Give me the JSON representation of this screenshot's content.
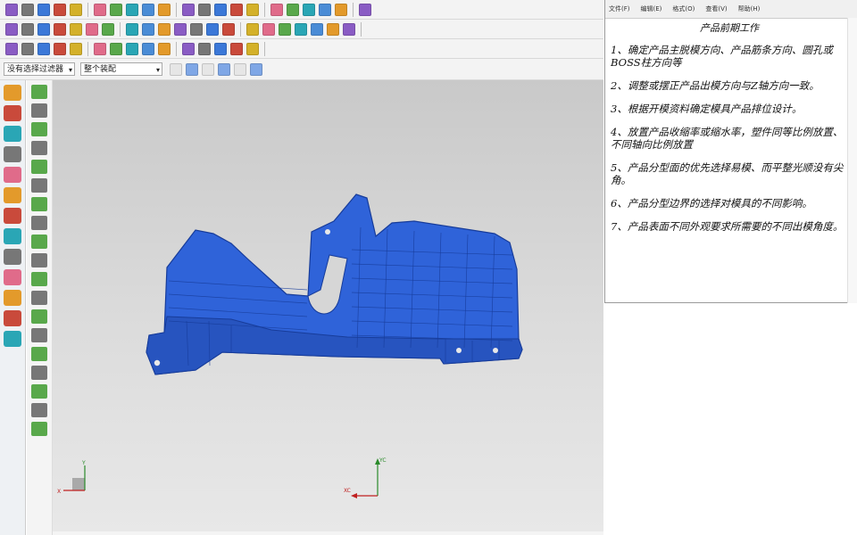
{
  "toolbar": {
    "row1_icons": [
      "start-icon",
      "new-file-icon",
      "open-folder-icon",
      "save-icon",
      "cut-icon",
      "undo-icon",
      "redo-icon",
      "refresh-icon",
      "sketch-icon",
      "grid-icon",
      "fit-view-icon",
      "zoom-icon",
      "box-view-icon",
      "rotate-icon",
      "pan-icon",
      "paint-icon",
      "shaded-icon",
      "wireframe-icon",
      "cube-icon",
      "magnet-icon",
      "line-tool-icon"
    ],
    "row2_icons": [
      "select-icon",
      "curve-icon",
      "extrude-icon",
      "revolve-icon",
      "hole-icon",
      "boss-icon",
      "blend-icon",
      "chamfer-icon",
      "shell-icon",
      "draft-icon",
      "trim-icon",
      "pattern-icon",
      "mirror-icon",
      "unite-icon",
      "subtract-icon",
      "intersect-icon",
      "offset-icon",
      "thicken-icon",
      "sweep-icon",
      "emboss-icon",
      "rib-icon"
    ],
    "row3_icons": [
      "measure-icon",
      "analyze-icon",
      "section-icon",
      "color-icon",
      "layer-icon",
      "move-face-icon",
      "replace-face-icon",
      "delete-face-icon",
      "split-body-icon",
      "mold-tool-icon",
      "parting-icon",
      "slider-icon",
      "lifter-icon",
      "insert-icon",
      "sprue-icon"
    ],
    "filter_combo": "没有选择过滤器",
    "assembly_combo": "整个装配",
    "snap_icons": [
      "snap-end-icon",
      "snap-mid-icon",
      "snap-center-icon",
      "snap-point-icon",
      "snap-quadrant-icon",
      "snap-intersect-icon"
    ]
  },
  "left_rail": {
    "icons": [
      "settings-icon",
      "part-nav-icon",
      "assembly-nav-icon",
      "constraint-icon",
      "reuse-library-icon",
      "web-browser-icon",
      "history-icon",
      "roles-icon",
      "system-materials-icon",
      "hd3d-icon",
      "palette-icon",
      "print-icon",
      "help-icon"
    ]
  },
  "tool_column": {
    "icons": [
      "init-project-icon",
      "workpiece-icon",
      "csys-icon",
      "shrink-icon",
      "layout-icon",
      "family-icon",
      "cavity-icon",
      "mold-base-icon",
      "standard-part-icon",
      "ejector-icon",
      "cooling-icon",
      "electrode-icon",
      "bom-icon",
      "drawing-icon",
      "trim-tool-icon",
      "pocket-icon",
      "view-manager-icon",
      "delete-icon",
      "cleanup-icon"
    ]
  },
  "notes": {
    "menu": [
      "文件(F)",
      "编辑(E)",
      "格式(O)",
      "查看(V)",
      "帮助(H)"
    ],
    "title": "产品前期工作",
    "items": [
      "1、确定产品主脱模方向、产品筋条方向、圆孔或BOSS柱方向等",
      "2、调整或摆正产品出模方向与Z轴方向一致。",
      "3、根据开模资料确定模具产品排位设计。",
      "4、放置产品收缩率或缩水率，塑件同等比例放置、不同轴向比例放置",
      "5、产品分型面的优先选择易模、而平整光顺没有尖角。",
      "6、产品分型边界的选择对模具的不同影响。",
      "7、产品表面不同外观要求所需要的不同出模角度。"
    ]
  },
  "viewport": {
    "model_color": "#2f63d9",
    "model_edge_color": "#173c9a",
    "triad_labels": {
      "x": "XC",
      "y": "YC",
      "z": "ZC",
      "wx": "X",
      "wy": "Y"
    }
  },
  "colors": {
    "accent": "#2f63d9",
    "toolbar_bg": "#f3f3f3",
    "viewport_top": "#c9c9c9",
    "viewport_bottom": "#e8e8e8"
  }
}
